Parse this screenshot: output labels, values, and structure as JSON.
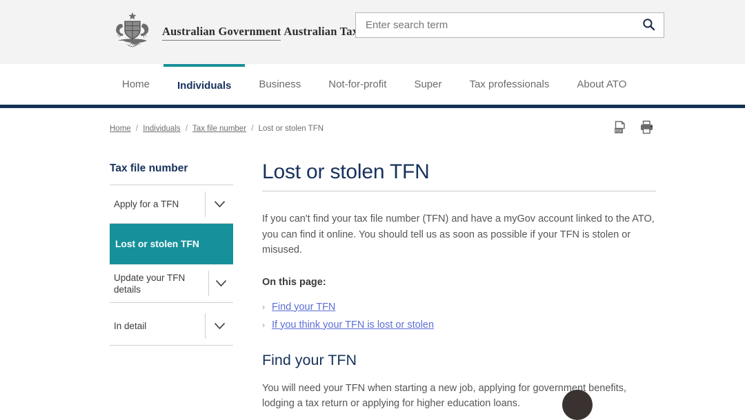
{
  "header": {
    "logo": {
      "icon": "australian-coat-of-arms",
      "line1": "Australian Government",
      "line2": "Australian Taxation Office"
    },
    "search": {
      "placeholder": "Enter search term",
      "value": "",
      "button_icon": "search-icon"
    }
  },
  "nav": {
    "items": [
      {
        "label": "Home",
        "active": false
      },
      {
        "label": "Individuals",
        "active": true
      },
      {
        "label": "Business",
        "active": false
      },
      {
        "label": "Not-for-profit",
        "active": false
      },
      {
        "label": "Super",
        "active": false
      },
      {
        "label": "Tax professionals",
        "active": false
      },
      {
        "label": "About ATO",
        "active": false
      }
    ],
    "active_accent_color": "#1a9099",
    "rule_color": "#123354"
  },
  "breadcrumb": {
    "items": [
      {
        "label": "Home",
        "link": true
      },
      {
        "label": "Individuals",
        "link": true
      },
      {
        "label": "Tax file number",
        "link": true
      },
      {
        "label": "Lost or stolen TFN",
        "link": false
      }
    ],
    "separator": "/"
  },
  "tools": [
    {
      "name": "pdf-download-icon",
      "label": "PDF"
    },
    {
      "name": "print-icon",
      "label": "Print"
    }
  ],
  "sidebar": {
    "title": "Tax file number",
    "items": [
      {
        "label": "Apply for a TFN",
        "active": false,
        "chevron": true
      },
      {
        "label": "Lost or stolen TFN",
        "active": true,
        "chevron": false
      },
      {
        "label": "Update your TFN details",
        "active": false,
        "chevron": true
      },
      {
        "label": "In detail",
        "active": false,
        "chevron": true
      }
    ],
    "active_color": "#16919b"
  },
  "main": {
    "title": "Lost or stolen TFN",
    "intro": "If you can't find your tax file number (TFN) and have a myGov account linked to the ATO, you can find it online. You should tell us as soon as possible if your TFN is stolen or misused.",
    "on_this_page_label": "On this page:",
    "toc": [
      {
        "label": "Find your TFN"
      },
      {
        "label": "If you think your TFN is lost or stolen"
      }
    ],
    "section_heading": "Find your TFN",
    "section_para": "You will need your TFN when starting a new job, applying for government benefits, lodging a tax return or applying for higher education loans."
  },
  "chat_widget": {
    "name": "chat-widget-button",
    "color": "#3a3230"
  }
}
